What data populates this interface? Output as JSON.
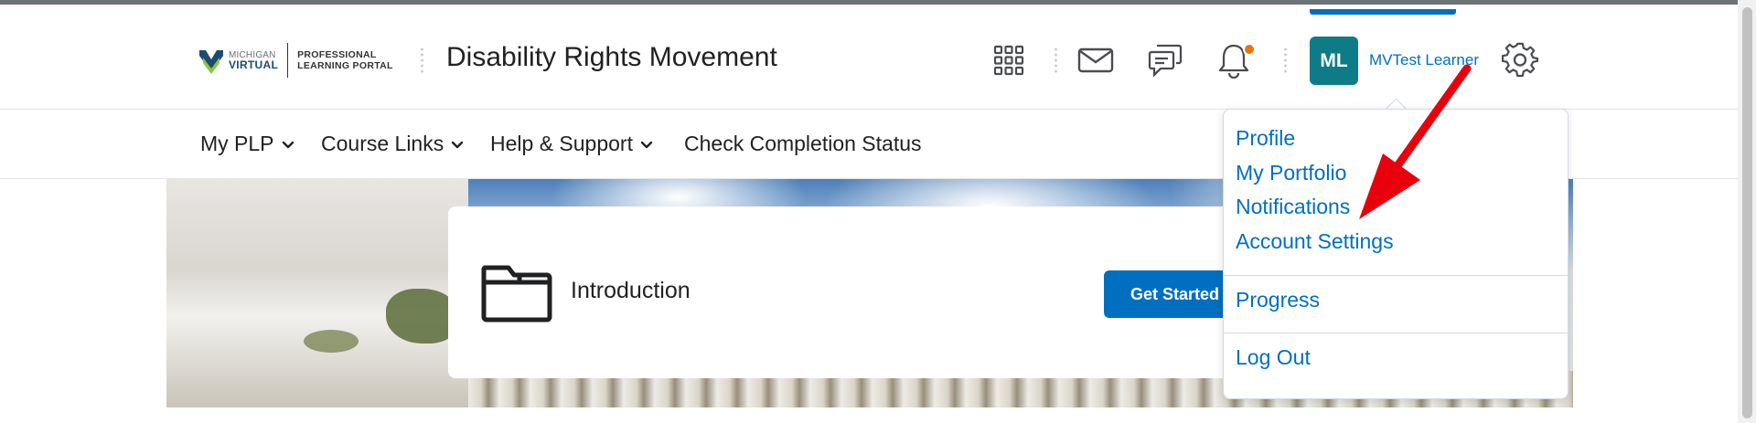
{
  "header": {
    "logo": {
      "line1": "MICHIGAN",
      "line2": "VIRTUAL",
      "portal_line1": "PROFESSIONAL",
      "portal_line2": "LEARNING PORTAL"
    },
    "course_title": "Disability Rights Movement",
    "icons": [
      "grid-icon",
      "mail-icon",
      "chat-icon",
      "bell-icon",
      "gear-icon"
    ],
    "user": {
      "initials": "ML",
      "name": "MVTest Learner"
    }
  },
  "nav": {
    "items": [
      {
        "label": "My PLP"
      },
      {
        "label": "Course Links"
      },
      {
        "label": "Help & Support"
      },
      {
        "label": "Check Completion Status"
      }
    ]
  },
  "module_card": {
    "title": "Introduction",
    "button_label": "Get Started"
  },
  "user_menu": {
    "items": [
      "Profile",
      "My Portfolio",
      "Notifications",
      "Account Settings"
    ],
    "progress": "Progress",
    "logout": "Log Out"
  },
  "colors": {
    "link": "#006fbf",
    "avatar": "#0e7c86",
    "notification_dot": "#e87511",
    "annotation_arrow": "#e8000d"
  }
}
